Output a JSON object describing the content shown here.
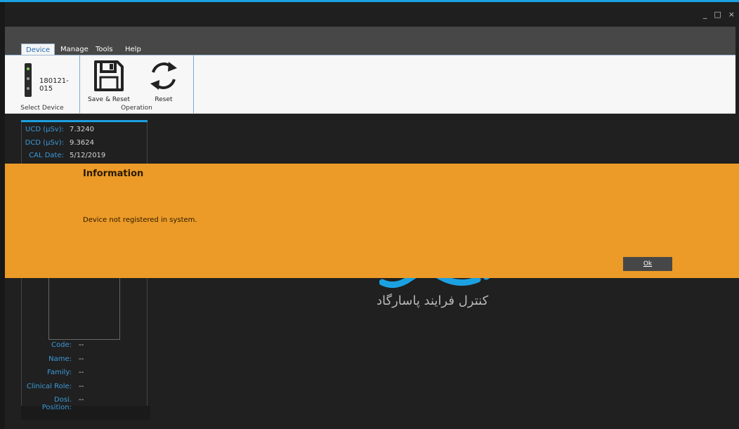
{
  "window": {
    "minimize": "_",
    "maximize": "□",
    "close": "×"
  },
  "tabs": [
    {
      "label": "Device",
      "active": true
    },
    {
      "label": "Manage",
      "active": false
    },
    {
      "label": "Tools",
      "active": false
    },
    {
      "label": "Help",
      "active": false
    }
  ],
  "ribbon": {
    "device_id": "180121-015",
    "select_device_label": "Select Device",
    "save_reset_label": "Save & Reset",
    "reset_label": "Reset",
    "operation_label": "Operation"
  },
  "device_info": {
    "ucd_label": "UCD (µSv):",
    "ucd_value": "7.3240",
    "dcd_label": "DCD (µSv):",
    "dcd_value": "9.3624",
    "cal_label": "CAL Date:",
    "cal_value": "5/12/2019"
  },
  "person_info": {
    "code_label": "Code:",
    "code_value": "--",
    "name_label": "Name:",
    "name_value": "--",
    "family_label": "Family:",
    "family_value": "--",
    "role_label": "Clinical Role:",
    "role_value": "--",
    "position_label": "Dosi. Position:",
    "position_value": "--"
  },
  "logo": {
    "text": "کنترل فرایند پاسارگاد"
  },
  "dialog": {
    "title": "Information",
    "message": "Device not registered in system.",
    "ok_label": "Ok"
  },
  "colors": {
    "accent": "#1ba1e2",
    "dialog_bg": "#ec9b28",
    "background": "#202020"
  }
}
